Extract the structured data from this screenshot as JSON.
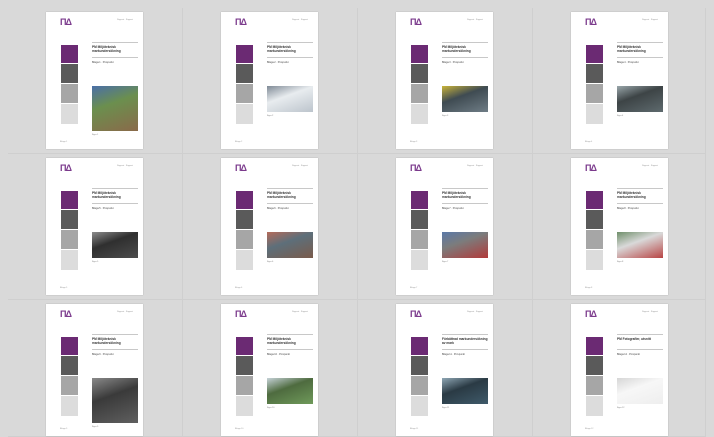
{
  "thumbnails": [
    {
      "logo": "ΠΔ",
      "header": "Rapport · Rapport",
      "title": "PM Miljöteknisk markundersökning",
      "subtitle": "Bilaga 1 · Provpunkt",
      "photo_colors": [
        "#8a6a4a",
        "#4a6fa8",
        "#6b8f4e"
      ],
      "photo_size": "tall",
      "caption": "Figur 1",
      "footer": "Bilaga 1"
    },
    {
      "logo": "ΠΔ",
      "header": "Rapport · Rapport",
      "title": "PM Miljöteknisk markundersökning",
      "subtitle": "Bilaga 2 · Provpunkt",
      "photo_colors": [
        "#bcc4cc",
        "#7f8a96",
        "#e8ecef"
      ],
      "photo_size": "short",
      "caption": "Figur 2",
      "footer": "Bilaga 2"
    },
    {
      "logo": "ΠΔ",
      "header": "Rapport · Rapport",
      "title": "PM Miljöteknisk markundersökning",
      "subtitle": "Bilaga 3 · Provpunkt",
      "photo_colors": [
        "#6f7d86",
        "#c9b43a",
        "#3f4b52"
      ],
      "photo_size": "short",
      "caption": "Figur 3",
      "footer": "Bilaga 3"
    },
    {
      "logo": "ΠΔ",
      "header": "Rapport · Rapport",
      "title": "PM Miljöteknisk markundersökning",
      "subtitle": "Bilaga 4 · Provpunkt",
      "photo_colors": [
        "#5e6a6e",
        "#9aa7ab",
        "#3d4446"
      ],
      "photo_size": "short",
      "caption": "Figur 4",
      "footer": "Bilaga 4"
    },
    {
      "logo": "ΠΔ",
      "header": "Rapport · Rapport",
      "title": "PM Miljöteknisk markundersökning",
      "subtitle": "Bilaga 5 · Provpunkt",
      "photo_colors": [
        "#4c4c4c",
        "#8c8c8c",
        "#2f2f2f"
      ],
      "photo_size": "short",
      "caption": "Figur 5",
      "footer": "Bilaga 5"
    },
    {
      "logo": "ΠΔ",
      "header": "Rapport · Rapport",
      "title": "PM Miljöteknisk markundersökning",
      "subtitle": "Bilaga 6 · Provpunkt",
      "photo_colors": [
        "#7a5b4b",
        "#b46b5a",
        "#5d6f7a"
      ],
      "photo_size": "short",
      "caption": "Figur 6",
      "footer": "Bilaga 6"
    },
    {
      "logo": "ΠΔ",
      "header": "Rapport · Rapport",
      "title": "PM Miljöteknisk markundersökning",
      "subtitle": "Bilaga 7 · Provpunkt",
      "photo_colors": [
        "#b23a3a",
        "#5b79a8",
        "#7c7c7c"
      ],
      "photo_size": "short",
      "caption": "Figur 7",
      "footer": "Bilaga 7"
    },
    {
      "logo": "ΠΔ",
      "header": "Rapport · Rapport",
      "title": "PM Miljöteknisk markundersökning",
      "subtitle": "Bilaga 8 · Provpunkt",
      "photo_colors": [
        "#b84444",
        "#6f8f6a",
        "#d9d9d9"
      ],
      "photo_size": "short",
      "caption": "Figur 8",
      "footer": "Bilaga 8"
    },
    {
      "logo": "ΠΔ",
      "header": "Rapport · Rapport",
      "title": "PM Miljöteknisk markundersökning",
      "subtitle": "Bilaga 9 · Provpunkt",
      "photo_colors": [
        "#5f5f5f",
        "#8a8a8a",
        "#3a3a3a"
      ],
      "photo_size": "tall",
      "caption": "Figur 9",
      "footer": "Bilaga 9"
    },
    {
      "logo": "ΠΔ",
      "header": "Rapport · Rapport",
      "title": "PM Miljöteknisk markundersökning",
      "subtitle": "Bilaga 10 · Provpunkt",
      "photo_colors": [
        "#6f9a5a",
        "#c6d2d8",
        "#4e6b3f"
      ],
      "photo_size": "short",
      "caption": "Figur 10",
      "footer": "Bilaga 10"
    },
    {
      "logo": "ΠΔ",
      "header": "Rapport · Rapport",
      "title": "Förbättrad markundersökning av mark",
      "subtitle": "Bilaga 11 · Provpunkt",
      "photo_colors": [
        "#3f5a6a",
        "#8fa7b5",
        "#2a3a44"
      ],
      "photo_size": "short",
      "caption": "Figur 11",
      "footer": "Bilaga 11"
    },
    {
      "logo": "ΠΔ",
      "header": "Rapport · Rapport",
      "title": "PM Fotografier, utsnitt",
      "subtitle": "Bilaga 12 · Provpunkt",
      "photo_colors": [
        "#eeeeee",
        "#d6d6d6",
        "#f7f7f7"
      ],
      "photo_size": "short",
      "caption": "Figur 12",
      "footer": "Bilaga 12"
    }
  ]
}
